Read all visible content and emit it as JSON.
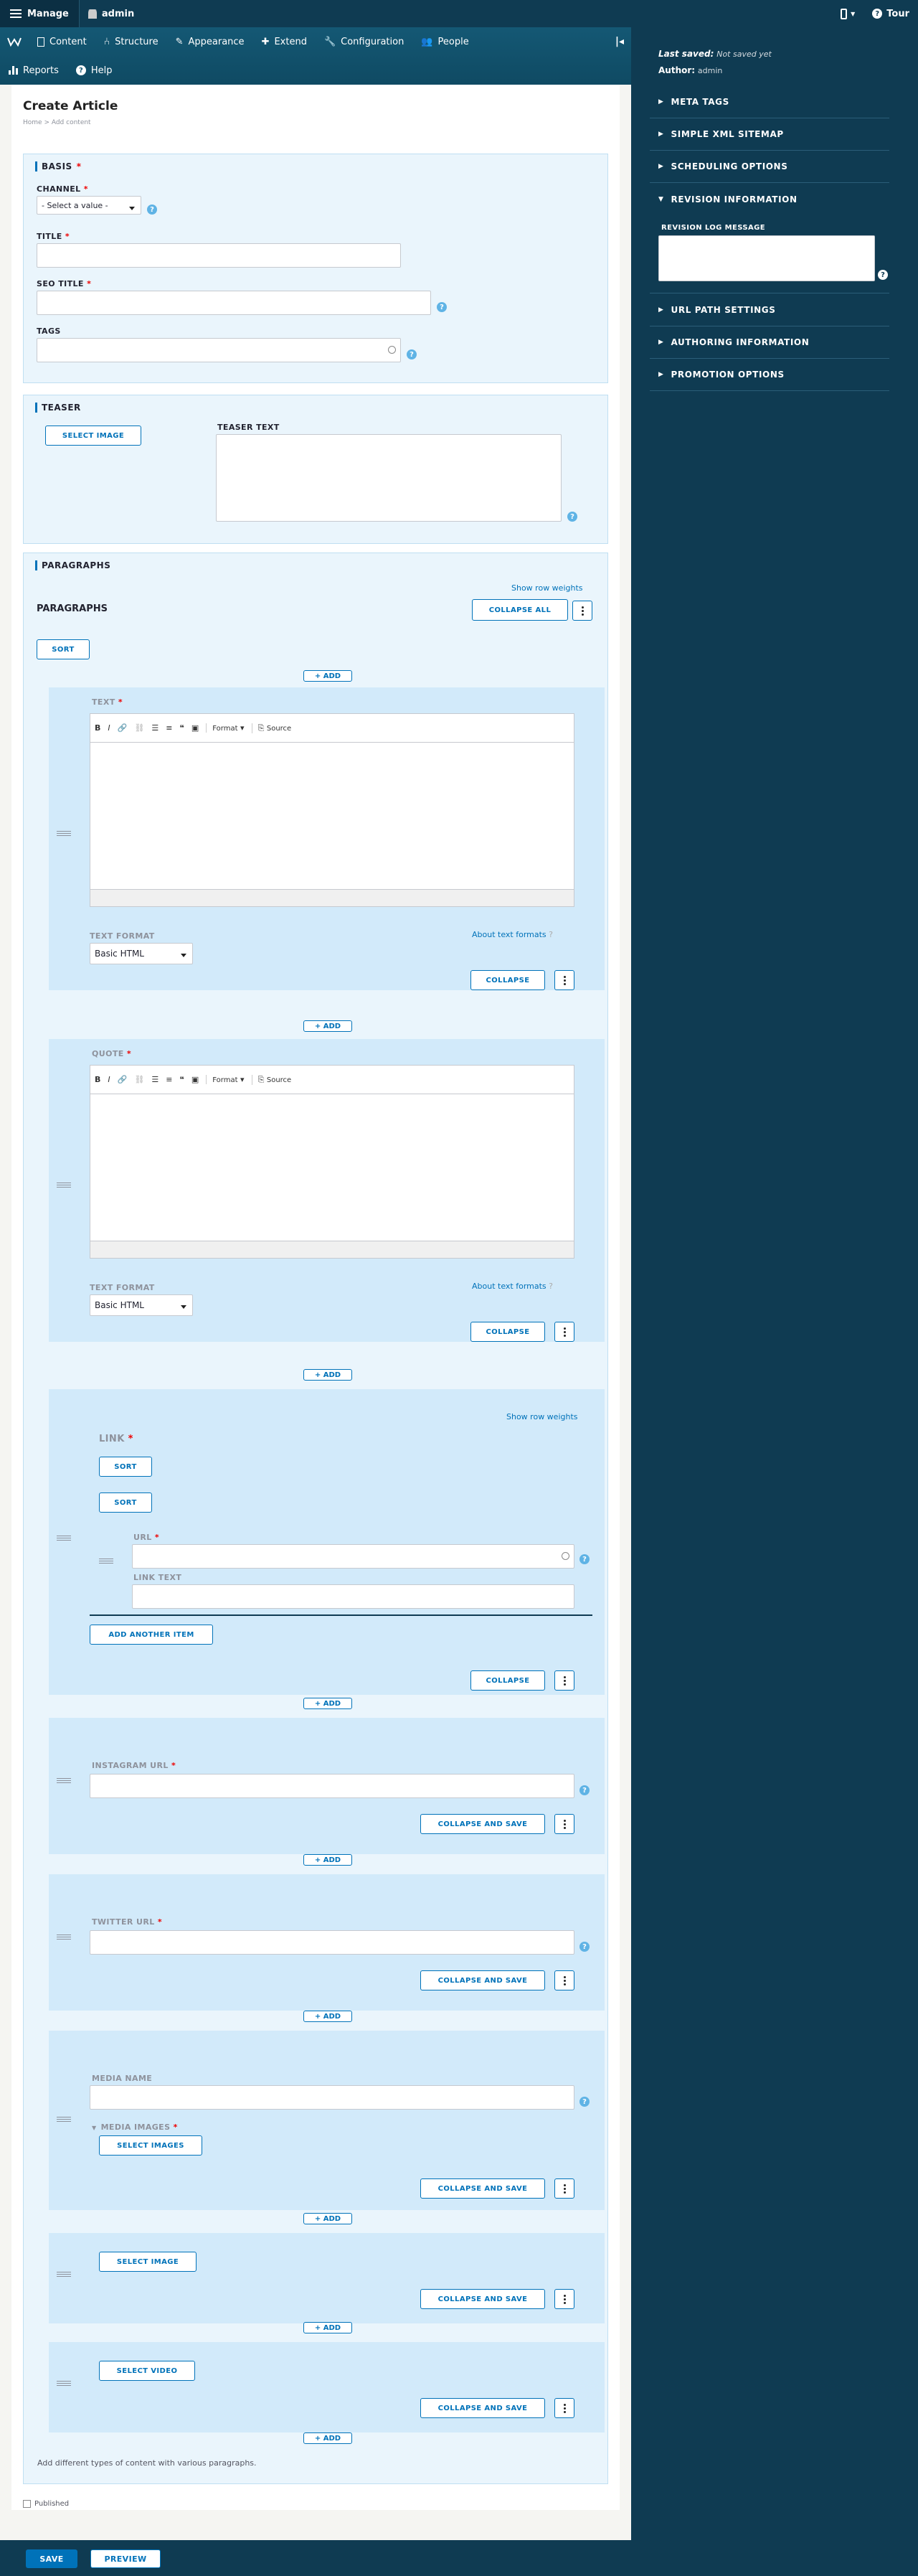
{
  "toolbar": {
    "manage": "Manage",
    "user": "admin",
    "tour": "Tour"
  },
  "tray": {
    "items": [
      "Content",
      "Structure",
      "Appearance",
      "Extend",
      "Configuration",
      "People"
    ],
    "items2": [
      "Reports",
      "Help"
    ]
  },
  "page": {
    "title": "Create Article",
    "breadcrumb": "Home > Add content"
  },
  "basis": {
    "legend": "BASIS",
    "channel_label": "CHANNEL",
    "channel_value": "- Select a value -",
    "title_label": "TITLE",
    "seo_label": "SEO TITLE",
    "tags_label": "TAGS"
  },
  "teaser": {
    "legend": "TEASER",
    "select_image": "SELECT IMAGE",
    "text_label": "TEASER TEXT"
  },
  "paragraphs": {
    "legend": "PARAGRAPHS",
    "heading": "PARAGRAPHS",
    "show_row_weights": "Show row weights",
    "collapse_all": "COLLAPSE ALL",
    "sort": "SORT",
    "add": "+ ADD",
    "editor_tools": {
      "bold": "B",
      "italic": "I",
      "format": "Format",
      "source": "Source"
    },
    "text": {
      "label": "TEXT",
      "format_label": "TEXT FORMAT",
      "format_value": "Basic HTML",
      "about": "About text formats",
      "collapse": "COLLAPSE"
    },
    "quote": {
      "label": "QUOTE",
      "format_label": "TEXT FORMAT",
      "format_value": "Basic HTML",
      "about": "About text formats",
      "collapse": "COLLAPSE"
    },
    "link": {
      "show_row_weights": "Show row weights",
      "label": "LINK",
      "sort1": "SORT",
      "sort2": "SORT",
      "url_label": "URL",
      "link_text_label": "LINK TEXT",
      "add_another": "ADD ANOTHER ITEM",
      "collapse": "COLLAPSE"
    },
    "instagram": {
      "label": "INSTAGRAM URL",
      "collapse_save": "COLLAPSE AND SAVE"
    },
    "twitter": {
      "label": "TWITTER URL",
      "collapse_save": "COLLAPSE AND SAVE"
    },
    "media": {
      "name_label": "MEDIA NAME",
      "images_label": "MEDIA IMAGES",
      "select_images": "SELECT IMAGES",
      "collapse_save": "COLLAPSE AND SAVE"
    },
    "image": {
      "select_image": "SELECT IMAGE",
      "collapse_save": "COLLAPSE AND SAVE"
    },
    "video": {
      "select_video": "SELECT VIDEO",
      "collapse_save": "COLLAPSE AND SAVE"
    },
    "description": "Add different types of content with various paragraphs."
  },
  "published_label": "Published",
  "sidebar": {
    "last_saved_label": "Last saved:",
    "last_saved_value": "Not saved yet",
    "author_label": "Author:",
    "author_value": "admin",
    "sections": [
      "META TAGS",
      "SIMPLE XML SITEMAP",
      "SCHEDULING OPTIONS",
      "REVISION INFORMATION",
      "URL PATH SETTINGS",
      "AUTHORING INFORMATION",
      "PROMOTION OPTIONS"
    ],
    "revision_log_label": "REVISION LOG MESSAGE"
  },
  "footer": {
    "save": "SAVE",
    "preview": "PREVIEW"
  }
}
